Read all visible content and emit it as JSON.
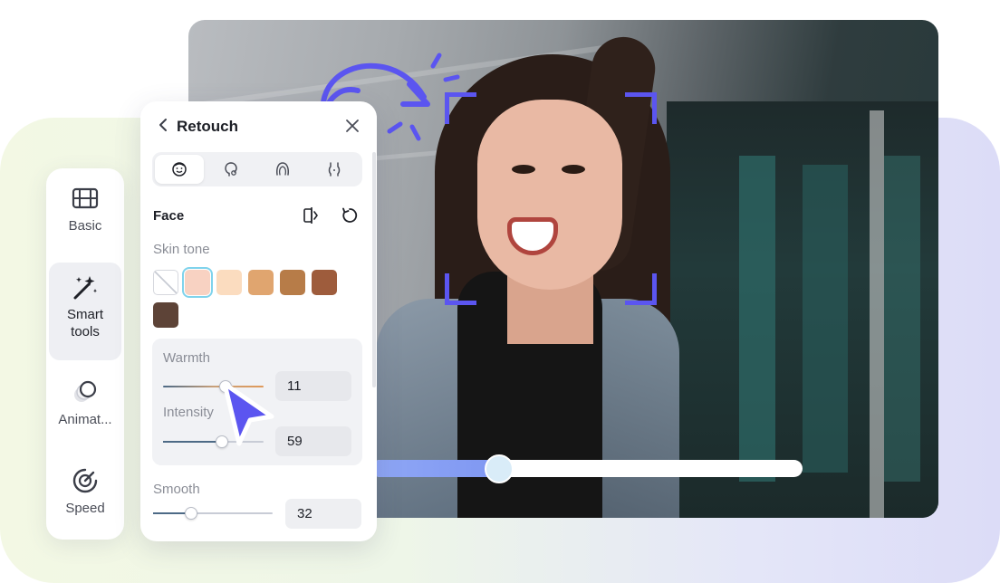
{
  "sidebar": {
    "items": [
      {
        "label": "Basic",
        "icon": "film-icon",
        "active": false
      },
      {
        "label": "Smart\ntools",
        "label_line1": "Smart",
        "label_line2": "tools",
        "icon": "magic-wand-icon",
        "active": true
      },
      {
        "label": "Animat...",
        "icon": "circles-icon",
        "active": false
      },
      {
        "label": "Speed",
        "icon": "speedometer-icon",
        "active": false
      }
    ]
  },
  "panel": {
    "title": "Retouch",
    "tabs": [
      "face-tab-icon",
      "head-tab-icon",
      "hair-tab-icon",
      "body-tab-icon"
    ],
    "active_tab": 0,
    "section": "Face",
    "skin_tone_label": "Skin tone",
    "swatches": [
      "#ffffff",
      "#f8d2c2",
      "#fbdcbf",
      "#e0a56f",
      "#b77c48",
      "#9e5c3c",
      "#5d4337"
    ],
    "selected_swatch": 1,
    "warmth": {
      "label": "Warmth",
      "value": "11",
      "fraction": 0.62
    },
    "intensity": {
      "label": "Intensity",
      "value": "59",
      "fraction": 0.59
    },
    "smooth": {
      "label": "Smooth",
      "value": "32",
      "fraction": 0.32
    }
  },
  "preview": {
    "slider_fraction": 0.3
  },
  "colors": {
    "accent": "#5b55f0",
    "slider_fill": "#8fa7f5"
  }
}
